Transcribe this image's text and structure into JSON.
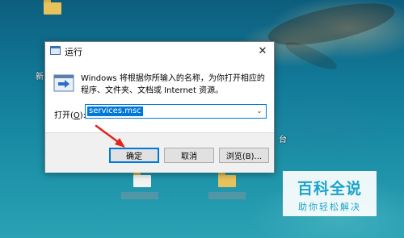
{
  "dialog": {
    "title": "运行",
    "description": "Windows 将根据你所输入的名称，为你打开相应的程序、文件夹、文档或 Internet 资源。",
    "open_label_prefix": "打开(",
    "open_label_hotkey": "O",
    "open_label_suffix": "):",
    "input_value": "services.msc",
    "buttons": {
      "ok": "确定",
      "cancel": "取消",
      "browse": "浏览(B)..."
    }
  },
  "desktop": {
    "left_icon_label_fragment": "新",
    "right_icon_label_fragment": "台"
  },
  "watermark": {
    "title": "百科全说",
    "subtitle": "助你轻松解决"
  },
  "colors": {
    "accent": "#0078d7",
    "arrow": "#e0231d",
    "watermark": "#1aa3c8"
  }
}
